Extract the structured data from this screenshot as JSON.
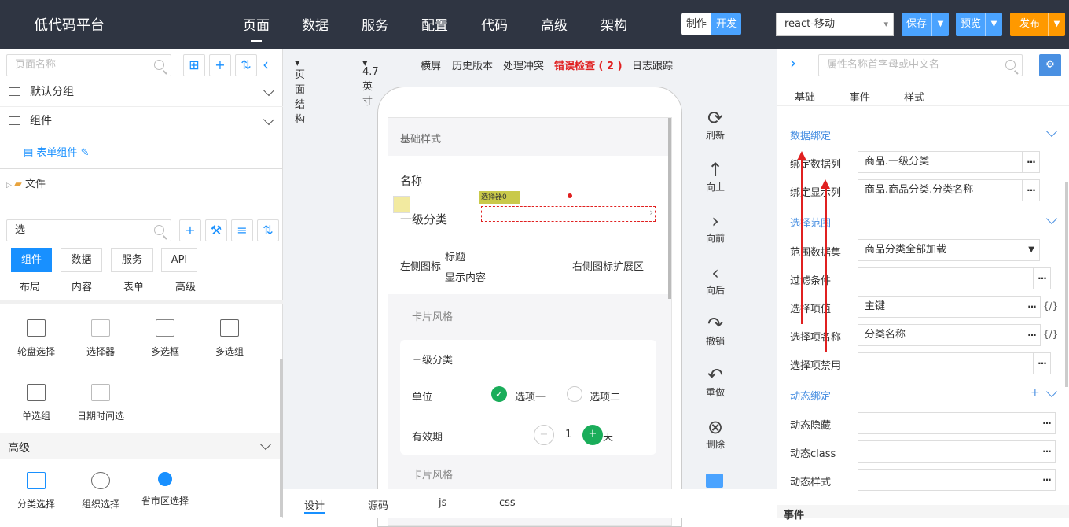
{
  "header": {
    "title": "低代码平台",
    "nav": [
      "页面",
      "数据",
      "服务",
      "配置",
      "代码",
      "高级",
      "架构"
    ],
    "mode": [
      "制作",
      "开发"
    ],
    "target": "react-移动",
    "save": "保存",
    "preview": "预览",
    "publish": "发布",
    "colors": {
      "bar": "#2f3542",
      "save": "#4aa3ff",
      "publish": "#ff9900"
    }
  },
  "left": {
    "page_search_placeholder": "页面名称",
    "groups": [
      "默认分组",
      "组件"
    ],
    "form_component": "表单组件",
    "files": "文件",
    "component_search": "选",
    "tabs": [
      "组件",
      "数据",
      "服务",
      "API"
    ],
    "cat_tabs": [
      "布局",
      "内容",
      "表单",
      "高级"
    ],
    "components": [
      "轮盘选择",
      "选择器",
      "多选框",
      "多选组",
      "单选组",
      "日期时间选"
    ],
    "advanced_header": "高级",
    "advanced": [
      "分类选择",
      "组织选择",
      "省市区选择"
    ]
  },
  "center": {
    "toolbar": [
      "页面结构",
      "4.7 英寸",
      "横屏",
      "历史版本",
      "处理冲突",
      "错误检查 ( 2 )",
      "日志跟踪"
    ],
    "phone": {
      "basic_style": "基础样式",
      "name": "名称",
      "picker_tag": "选择器0",
      "field_label": "一级分类",
      "left_icon": "左侧图标",
      "title": "标题",
      "content": "显示内容",
      "right_ext": "右侧图标扩展区",
      "card_style": "卡片风格",
      "third_cat": "三级分类",
      "unit": "单位",
      "opt1": "选项一",
      "opt2": "选项二",
      "validity": "有效期",
      "num": "1",
      "day": "天",
      "card_style2": "卡片风格"
    },
    "tools": [
      "刷新",
      "向上",
      "向前",
      "向后",
      "撤销",
      "重做",
      "删除"
    ],
    "bottom_tabs": [
      "设计",
      "源码",
      "js",
      "css"
    ]
  },
  "right": {
    "search_placeholder": "属性名称首字母或中文名",
    "tabs": [
      "基础",
      "事件",
      "样式"
    ],
    "data_binding": "数据绑定",
    "bind_col_label": "绑定数据列",
    "bind_col_value": "商品.一级分类",
    "show_col_label": "绑定显示列",
    "show_col_value": "商品.商品分类.分类名称",
    "range": "选择范围",
    "range_ds_label": "范围数据集",
    "range_ds_value": "商品分类全部加载",
    "filter_label": "过滤条件",
    "item_value_label": "选择项值",
    "item_value": "主键",
    "item_name_label": "选择项名称",
    "item_name": "分类名称",
    "item_disabled_label": "选择项禁用",
    "dynamic": "动态绑定",
    "plus": "+",
    "dyn_hide": "动态隐藏",
    "dyn_class": "动态class",
    "dyn_style": "动态样式",
    "events": "事件",
    "braces": "{/}",
    "more": "..."
  }
}
